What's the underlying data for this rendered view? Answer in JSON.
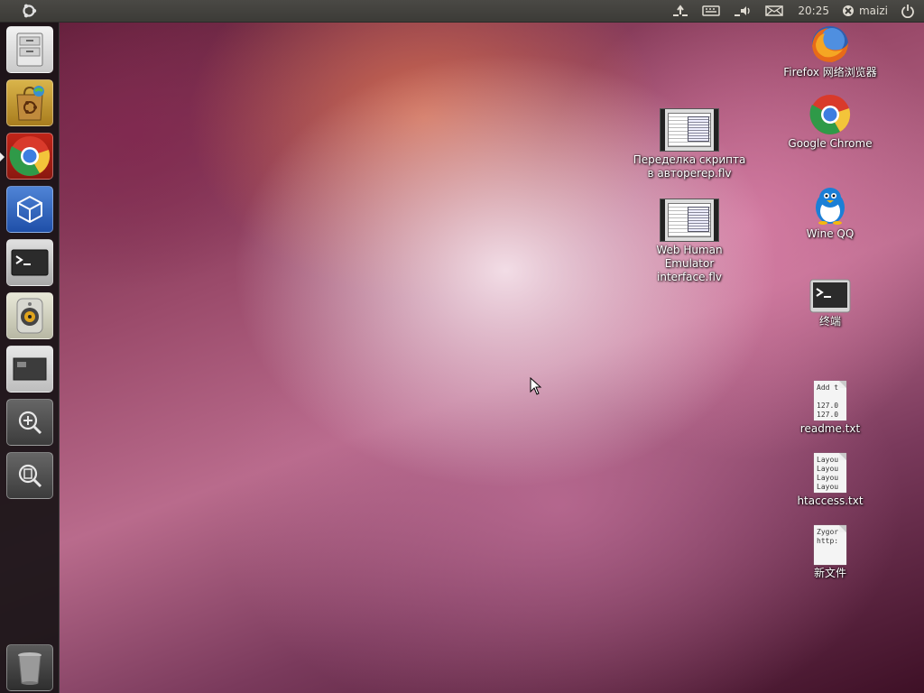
{
  "top_panel": {
    "clock": "20:25",
    "user": "maizi",
    "indicators": [
      "network-icon",
      "keyboard-icon",
      "volume-icon",
      "mail-icon"
    ]
  },
  "launcher": {
    "items": [
      {
        "name": "files-drawer",
        "icon": "file-cabinet-icon",
        "running": false
      },
      {
        "name": "ubuntu-software-center",
        "icon": "shopping-bag-icon",
        "running": false
      },
      {
        "name": "google-chrome",
        "icon": "chrome-icon",
        "running": true
      },
      {
        "name": "virtualbox",
        "icon": "virtualbox-cube-icon",
        "running": false
      },
      {
        "name": "terminal",
        "icon": "terminal-icon",
        "running": false
      },
      {
        "name": "rhythmbox",
        "icon": "speaker-icon",
        "running": false
      },
      {
        "name": "workspace-switcher",
        "icon": "window-icon",
        "running": false
      },
      {
        "name": "applications-lens",
        "icon": "zoom-plus-icon",
        "running": false
      },
      {
        "name": "files-lens",
        "icon": "file-search-icon",
        "running": false
      },
      {
        "name": "trash",
        "icon": "trash-icon",
        "running": false
      }
    ]
  },
  "desktop": {
    "icons": [
      {
        "label": "Firefox 网络浏览器",
        "type": "firefox"
      },
      {
        "label": "Google Chrome",
        "type": "chrome"
      },
      {
        "label": "Wine QQ",
        "type": "penguin"
      },
      {
        "label": "终端",
        "type": "terminal"
      },
      {
        "label": "readme.txt",
        "type": "text",
        "preview": "Add t\n\n127.0\n127.0"
      },
      {
        "label": "htaccess.txt",
        "type": "text",
        "preview": "Layou\nLayou\nLayou\nLayou"
      },
      {
        "label": "新文件",
        "type": "text",
        "preview": "Zygor\nhttp:"
      },
      {
        "label": "Переделка скрипта в автореrер.flv",
        "type": "video"
      },
      {
        "label": "Web Human Emulator interface.flv",
        "type": "video"
      }
    ]
  },
  "colors": {
    "panel": "#3c3b37",
    "launcher": "#181416",
    "accent": "#dd4814"
  }
}
